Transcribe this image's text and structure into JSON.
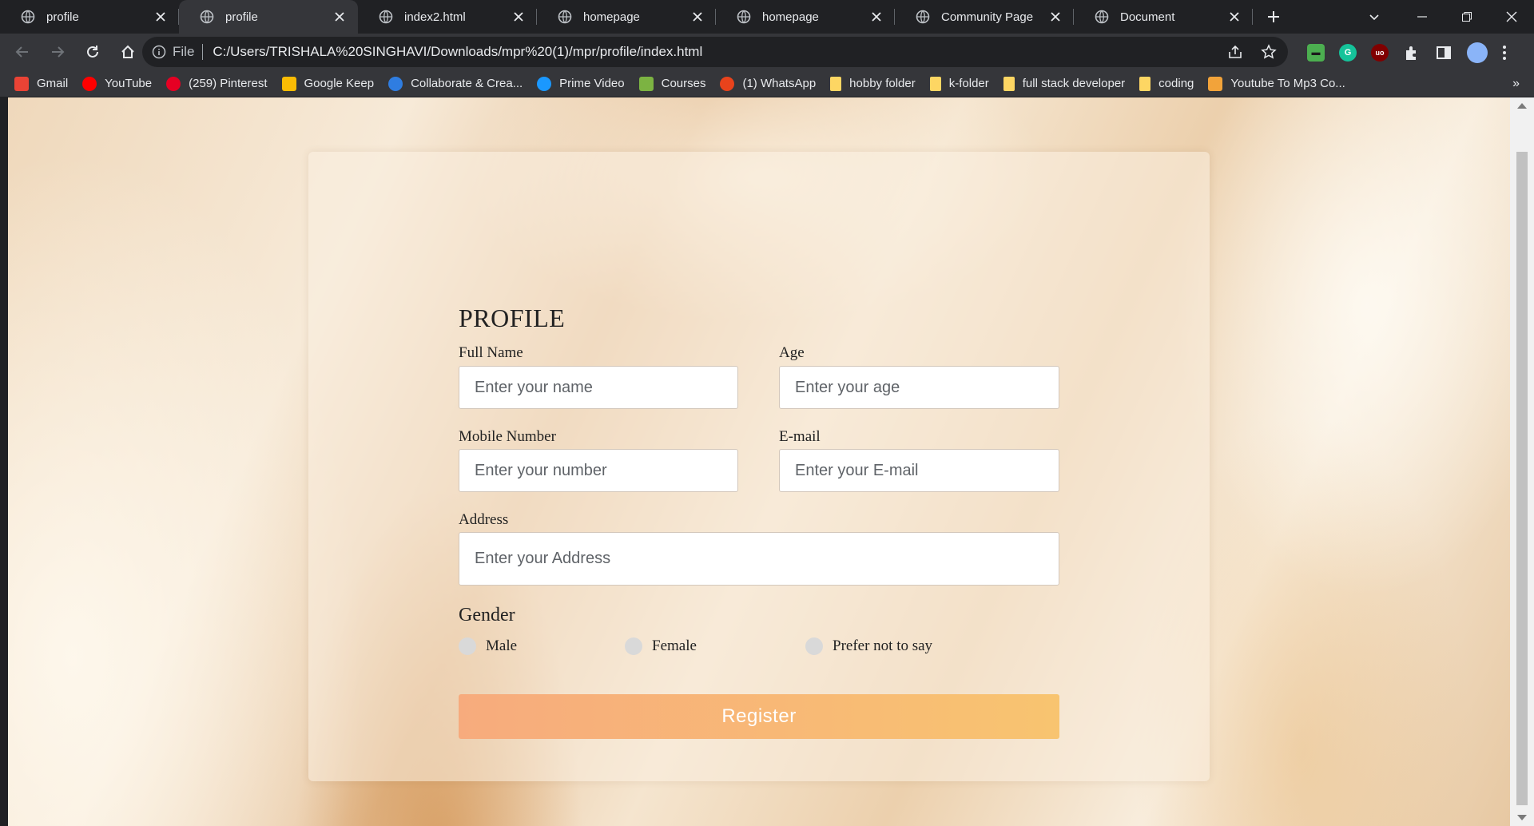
{
  "tabs": [
    {
      "label": "profile",
      "active": false
    },
    {
      "label": "profile",
      "active": true
    },
    {
      "label": "index2.html",
      "active": false
    },
    {
      "label": "homepage",
      "active": false
    },
    {
      "label": "homepage",
      "active": false
    },
    {
      "label": "Community Page",
      "active": false
    },
    {
      "label": "Document",
      "active": false
    }
  ],
  "omnibox": {
    "scheme_label": "File",
    "url": "C:/Users/TRISHALA%20SINGHAVI/Downloads/mpr%20(1)/mpr/profile/index.html"
  },
  "bookmarks": [
    {
      "label": "Gmail",
      "icon": "gmail-icon",
      "color": "#ea4335"
    },
    {
      "label": "YouTube",
      "icon": "youtube-icon",
      "color": "#ff0000"
    },
    {
      "label": "(259) Pinterest",
      "icon": "pinterest-icon",
      "color": "#e60023"
    },
    {
      "label": "Google Keep",
      "icon": "keep-icon",
      "color": "#fbbc04"
    },
    {
      "label": "Collaborate & Crea...",
      "icon": "canva-icon",
      "color": "#2f7de1"
    },
    {
      "label": "Prime Video",
      "icon": "prime-video-icon",
      "color": "#1a98ff"
    },
    {
      "label": "Courses",
      "icon": "courses-icon",
      "color": "#7cb342"
    },
    {
      "label": "(1) WhatsApp",
      "icon": "whatsapp-icon",
      "color": "#e8431c"
    },
    {
      "label": "hobby folder",
      "icon": "folder-icon",
      "color": "#fdd663"
    },
    {
      "label": "k-folder",
      "icon": "folder-icon",
      "color": "#fdd663"
    },
    {
      "label": "full stack developer",
      "icon": "folder-icon",
      "color": "#fdd663"
    },
    {
      "label": "coding",
      "icon": "folder-icon",
      "color": "#fdd663"
    },
    {
      "label": "Youtube To Mp3 Co...",
      "icon": "mp3-converter-icon",
      "color": "#f2a33a"
    }
  ],
  "form": {
    "title": "PROFILE",
    "full_name": {
      "label": "Full Name",
      "placeholder": "Enter your name"
    },
    "age": {
      "label": "Age",
      "placeholder": "Enter your age"
    },
    "mobile": {
      "label": "Mobile Number",
      "placeholder": "Enter your number"
    },
    "email": {
      "label": "E-mail",
      "placeholder": "Enter your E-mail"
    },
    "address": {
      "label": "Address",
      "placeholder": "Enter your Address"
    },
    "gender": {
      "title": "Gender",
      "options": [
        "Male",
        "Female",
        "Prefer not to say"
      ]
    },
    "register_label": "Register"
  },
  "colors": {
    "register_gradient_start": "#f7ab7d",
    "register_gradient_end": "#f8c470",
    "chrome_dark": "#202124",
    "chrome_toolbar": "#35363a"
  }
}
